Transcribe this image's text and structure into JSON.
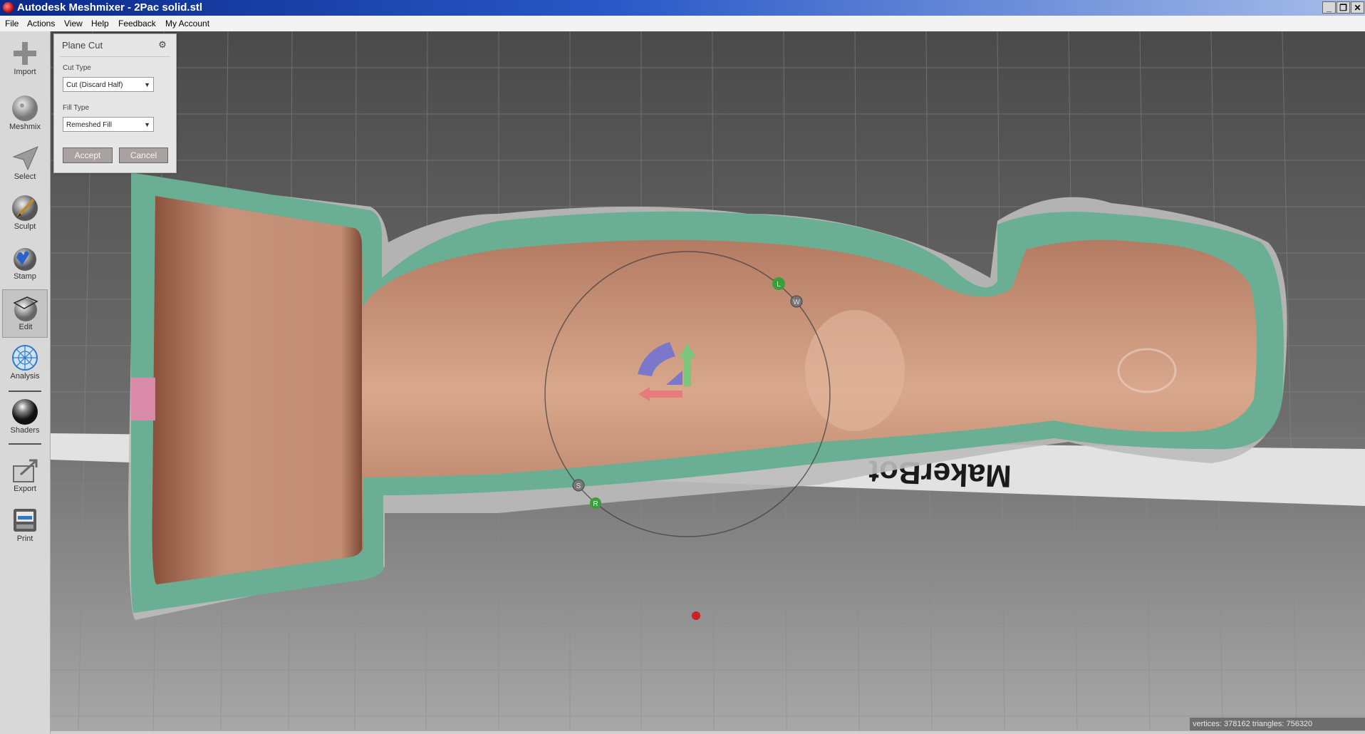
{
  "window": {
    "title": "Autodesk Meshmixer - 2Pac solid.stl",
    "controls": {
      "minimize": "_",
      "restore": "❐",
      "close": "✕"
    }
  },
  "menu": [
    "File",
    "Actions",
    "View",
    "Help",
    "Feedback",
    "My Account"
  ],
  "toolbar": {
    "tools": [
      {
        "label": "Import",
        "icon": "plus-icon"
      },
      {
        "label": "Meshmix",
        "icon": "meshmix-icon"
      },
      {
        "label": "Select",
        "icon": "arrow-cursor-icon"
      },
      {
        "label": "Sculpt",
        "icon": "brush-icon"
      },
      {
        "label": "Stamp",
        "icon": "stamp-icon"
      },
      {
        "label": "Edit",
        "icon": "edit-icon",
        "active": true
      },
      {
        "label": "Analysis",
        "icon": "analysis-icon"
      },
      {
        "label": "Shaders",
        "icon": "sphere-icon"
      },
      {
        "label": "Export",
        "icon": "export-icon"
      },
      {
        "label": "Print",
        "icon": "printer-icon"
      }
    ]
  },
  "panel": {
    "title": "Plane Cut",
    "cut_type_label": "Cut Type",
    "cut_type_value": "Cut (Discard Half)",
    "fill_type_label": "Fill Type",
    "fill_type_value": "Remeshed Fill",
    "accept_label": "Accept",
    "cancel_label": "Cancel"
  },
  "gizmo": {
    "handle_labels": [
      "L",
      "W",
      "S",
      "R"
    ]
  },
  "bed_text": "MakerBot",
  "status": "vertices: 378162 triangles: 756320",
  "colors": {
    "model_skin": "#c89073",
    "cut_fill": "#6aae94",
    "background": "#7a7a7a",
    "title_bar": "#1a3fa8"
  }
}
